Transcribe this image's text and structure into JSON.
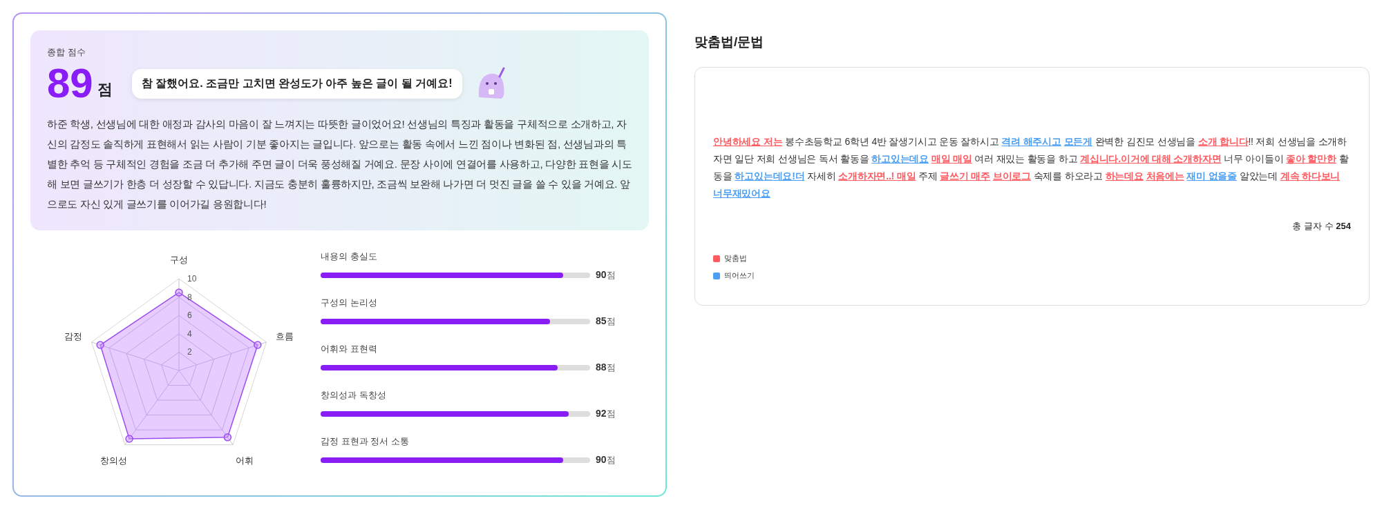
{
  "overall": {
    "label": "종합 점수",
    "score": "89",
    "unit": "점",
    "comment": "참 잘했어요. 조금만 고치면 완성도가 아주 높은 글이 될 거예요!",
    "feedback": "하준 학생, 선생님에 대한 애정과 감사의 마음이 잘 느껴지는 따뜻한 글이었어요! 선생님의 특징과 활동을 구체적으로 소개하고, 자신의 감정도 솔직하게 표현해서 읽는 사람이 기분 좋아지는 글입니다. 앞으로는 활동 속에서 느낀 점이나 변화된 점, 선생님과의 특별한 추억 등 구체적인 경험을 조금 더 추가해 주면 글이 더욱 풍성해질 거예요. 문장 사이에 연결어를 사용하고, 다양한 표현을 시도해 보면 글쓰기가 한층 더 성장할 수 있답니다. 지금도 충분히 훌륭하지만, 조금씩 보완해 나가면 더 멋진 글을 쓸 수 있을 거예요. 앞으로도 자신 있게 글쓰기를 이어가길 응원합니다!"
  },
  "radar": {
    "chart_data": {
      "type": "radar",
      "categories": [
        "구성",
        "흐름",
        "어휘",
        "창의성",
        "감정"
      ],
      "values": [
        8.5,
        9,
        9,
        9.2,
        9
      ],
      "ylim": [
        0,
        10
      ],
      "yticks": [
        2,
        4,
        6,
        8,
        10
      ]
    }
  },
  "criteria": [
    {
      "label": "내용의 충실도",
      "level": 0.9,
      "score": "90",
      "unit": "점"
    },
    {
      "label": "구성의 논리성",
      "level": 0.85,
      "score": "85",
      "unit": "점"
    },
    {
      "label": "어휘와 표현력",
      "level": 0.88,
      "score": "88",
      "unit": "점"
    },
    {
      "label": "창의성과 독창성",
      "level": 0.92,
      "score": "92",
      "unit": "점"
    },
    {
      "label": "감정 표현과 정서 소통",
      "level": 0.9,
      "score": "90",
      "unit": "점"
    }
  ],
  "grammar": {
    "title": "맞춤법/문법",
    "segments": [
      {
        "kind": "spelling",
        "text": "안녕하세요 저는"
      },
      {
        "kind": "plain",
        "text": " 봉수초등학교 6학년 4반 잘생기시고 운동 잘하시고 "
      },
      {
        "kind": "spacing",
        "text": "격려 해주시고"
      },
      {
        "kind": "spacing",
        "text": "모든게"
      },
      {
        "kind": "plain",
        "text": " 완벽한 김진모 선생님을 "
      },
      {
        "kind": "spelling",
        "text": "소개 합니다"
      },
      {
        "kind": "plain",
        "text": "!! 저희 선생님을 소개하자면 일단 저희 선생님은 독서 활동을 "
      },
      {
        "kind": "spacing",
        "text": "하고있는데요"
      },
      {
        "kind": "spelling",
        "text": "매일 매일"
      },
      {
        "kind": "plain",
        "text": " 여러 재밌는 활동을 하고 "
      },
      {
        "kind": "spelling",
        "text": "계십니다.이거에 대해 소개하자면"
      },
      {
        "kind": "plain",
        "text": " 너무 아이들이 "
      },
      {
        "kind": "spelling",
        "text": "좋아 할만한"
      },
      {
        "kind": "plain",
        "text": " 활동을 "
      },
      {
        "kind": "spacing",
        "text": "하고있는데요!더"
      },
      {
        "kind": "plain",
        "text": " 자세히 "
      },
      {
        "kind": "spelling",
        "text": "소개하자면..! 매일"
      },
      {
        "kind": "plain",
        "text": " 주제 "
      },
      {
        "kind": "spelling",
        "text": "글쓰기 매주"
      },
      {
        "kind": "spelling",
        "text": "브이로그"
      },
      {
        "kind": "plain",
        "text": " 숙제를 하오라고 "
      },
      {
        "kind": "spelling",
        "text": "하는데요"
      },
      {
        "kind": "spelling",
        "text": "처음에는"
      },
      {
        "kind": "spacing",
        "text": "재미 없을줄"
      },
      {
        "kind": "plain",
        "text": " 알았는데 "
      },
      {
        "kind": "spelling",
        "text": "계속 하다보니"
      },
      {
        "kind": "spacing",
        "text": "너무재밌어요"
      }
    ],
    "count_label": "총 글자 수",
    "count": "254",
    "legend": [
      {
        "kind": "spelling",
        "label": "맞춤법",
        "color": "#ff5a60"
      },
      {
        "kind": "spacing",
        "label": "띄어쓰기",
        "color": "#4a9ff5"
      }
    ]
  }
}
